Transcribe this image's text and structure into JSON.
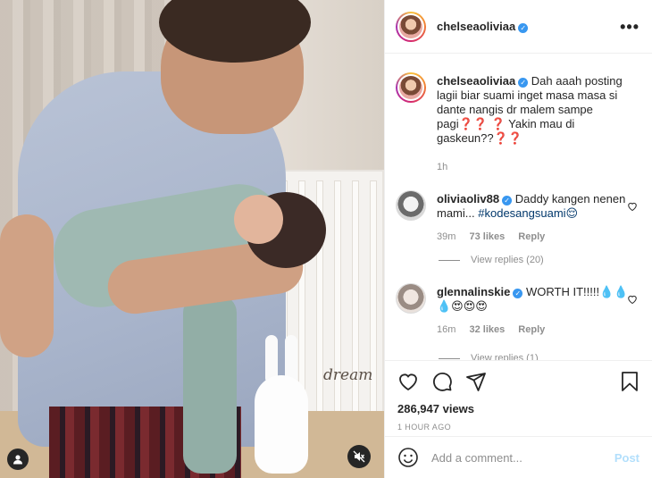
{
  "post": {
    "username": "chelseaoliviaa",
    "more_icon": "more-horizontal-icon",
    "caption": "Dah aaah posting lagii biar suami inget masa masa si dante nangis dr malem sampe pagi❓❓ ❓ Yakin mau di gaskeun??❓❓",
    "caption_time": "1h",
    "media_text": "dream"
  },
  "comments": [
    {
      "username": "oliviaoliv88",
      "text": "Daddy kangen nenen mami...",
      "hashtag": "#kodesangsuami😌",
      "time": "39m",
      "likes": "73 likes",
      "reply": "Reply",
      "view_replies": "View replies (20)"
    },
    {
      "username": "glennalinskie",
      "text": "WORTH IT!!!!!💧💧💧😍😍😍",
      "time": "16m",
      "likes": "32 likes",
      "reply": "Reply",
      "view_replies": "View replies (1)"
    }
  ],
  "stats": {
    "views": "286,947 views",
    "time_ago": "1 HOUR AGO"
  },
  "add_comment": {
    "placeholder": "Add a comment...",
    "post_label": "Post"
  },
  "colors": {
    "verified": "#3897f0",
    "hashtag": "#00376b",
    "muted": "#8e8e8e",
    "post_disabled": "#b2dffc"
  }
}
